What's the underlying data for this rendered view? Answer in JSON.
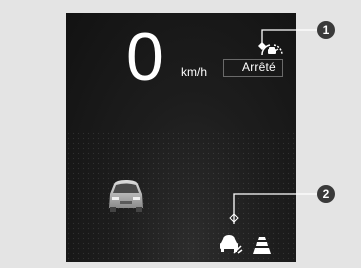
{
  "display": {
    "speed_value": "0",
    "speed_unit": "km/h",
    "status_text": "Arrêté"
  },
  "callouts": {
    "one": "1",
    "two": "2"
  },
  "icons": {
    "acc_status": "acc-vehicle-speed-icon",
    "lead_vehicle": "vehicle-rear-icon",
    "following_distance": "following-distance-car-icon",
    "lane_keeping": "lane-lines-icon"
  },
  "colors": {
    "screen_bg": "#1a1a1a",
    "text": "#ffffff",
    "callout": "#3a3a3a",
    "page_bg": "#e4e4e4"
  }
}
